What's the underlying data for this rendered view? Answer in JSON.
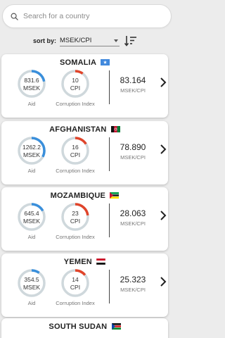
{
  "search": {
    "placeholder": "Search for a country",
    "icon": "search-icon"
  },
  "sort": {
    "label": "sort by:",
    "selected": "MSEK/CPI",
    "order_icon": "sort-descending-icon"
  },
  "colors": {
    "aid_arc": "#3a8fdb",
    "cpi_arc": "#e0442a",
    "ring_track": "#cfd8dc"
  },
  "countries": [
    {
      "name": "SOMALIA",
      "flag": "somalia-flag",
      "aid": "831.6",
      "aid_unit": "MSEK",
      "aid_label": "Aid",
      "cpi": "10",
      "cpi_unit": "CPI",
      "cpi_label": "Corruption Index",
      "ratio": "83.164",
      "ratio_unit": "MSEK/CPI",
      "aid_fraction": 0.22,
      "cpi_fraction": 0.1
    },
    {
      "name": "AFGHANISTAN",
      "flag": "afghanistan-flag",
      "aid": "1262.2",
      "aid_unit": "MSEK",
      "aid_label": "Aid",
      "cpi": "16",
      "cpi_unit": "CPI",
      "cpi_label": "Corruption Index",
      "ratio": "78.890",
      "ratio_unit": "MSEK/CPI",
      "aid_fraction": 0.33,
      "cpi_fraction": 0.16
    },
    {
      "name": "MOZAMBIQUE",
      "flag": "mozambique-flag",
      "aid": "645.4",
      "aid_unit": "MSEK",
      "aid_label": "Aid",
      "cpi": "23",
      "cpi_unit": "CPI",
      "cpi_label": "Corruption Index",
      "ratio": "28.063",
      "ratio_unit": "MSEK/CPI",
      "aid_fraction": 0.17,
      "cpi_fraction": 0.23
    },
    {
      "name": "YEMEN",
      "flag": "yemen-flag",
      "aid": "354.5",
      "aid_unit": "MSEK",
      "aid_label": "Aid",
      "cpi": "14",
      "cpi_unit": "CPI",
      "cpi_label": "Corruption Index",
      "ratio": "25.323",
      "ratio_unit": "MSEK/CPI",
      "aid_fraction": 0.1,
      "cpi_fraction": 0.14
    },
    {
      "name": "SOUTH SUDAN",
      "flag": "south-sudan-flag"
    }
  ]
}
